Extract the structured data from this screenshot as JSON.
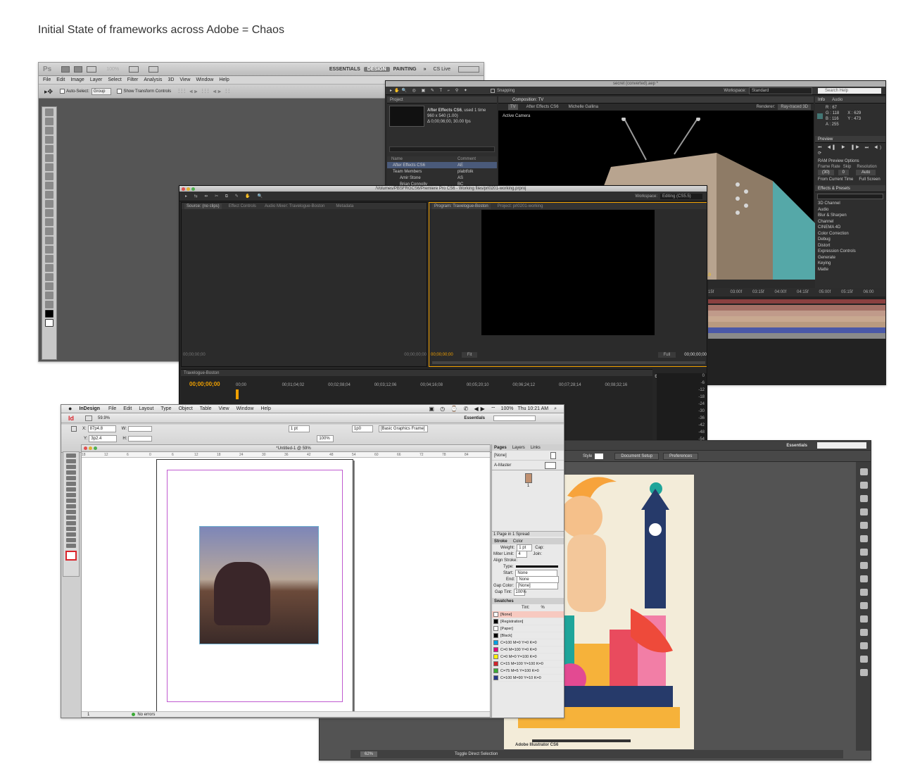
{
  "page": {
    "title": "Initial State of frameworks across Adobe = Chaos"
  },
  "photoshop": {
    "logo": "Ps",
    "zoom": "100%",
    "workspaces": [
      "ESSENTIALS",
      "DESIGN",
      "PAINTING"
    ],
    "more": "»",
    "cslive": "CS Live",
    "menus": [
      "File",
      "Edit",
      "Image",
      "Layer",
      "Select",
      "Filter",
      "Analysis",
      "3D",
      "View",
      "Window",
      "Help"
    ],
    "options": {
      "auto_select": "Auto-Select:",
      "group": "Group",
      "transform": "Show Transform Controls"
    }
  },
  "after_effects": {
    "title": "secret (converted).aep *",
    "snapping": "Snapping",
    "workspace_label": "Workspace:",
    "workspace": "Standard",
    "search_help": "Search Help",
    "project_tab": "Project",
    "project_item": "After Effects CS6",
    "project_used": ", used 1 time",
    "project_dims": "960 x 540 (1.00)",
    "project_time": "Δ 0;00;06;00, 30.00 fps",
    "col_name": "Name",
    "col_comment": "Comment",
    "rows": [
      {
        "name": "After Effects CS6",
        "comment": "AE"
      },
      {
        "name": "Team Members",
        "comment": "plabtfolk"
      },
      {
        "name": "Amir Stone",
        "comment": "AS"
      },
      {
        "name": "Brian Connolly",
        "comment": "BC"
      }
    ],
    "comp_tab": "Composition: TV",
    "comp_crumbs": [
      "TV",
      "After Effects CS6",
      "Michelle Gallina"
    ],
    "renderer_label": "Renderer:",
    "renderer": "Ray-traced 3D",
    "active_camera": "Active Camera",
    "info_tab": "Info",
    "audio_tab": "Audio",
    "info": {
      "r": "R : 67",
      "g": "G : 118",
      "b": "B : 116",
      "a": "A : 255",
      "x": "X : 629",
      "y": "Y : 473"
    },
    "preview_tab": "Preview",
    "ram_options": "RAM Preview Options",
    "frame_rate": "Frame Rate",
    "skip": "Skip",
    "resolution": "Resolution",
    "frame_rate_val": "(30)",
    "skip_val": "0",
    "res_val": "Auto",
    "from_current": "From Current Time",
    "full_screen": "Full Screen",
    "effects_tab": "Effects & Presets",
    "effects": [
      "3D Channel",
      "Audio",
      "Blur & Sharpen",
      "Channel",
      "CINEMA 4D",
      "Color Correction",
      "Debug",
      "Distort",
      "Expression Controls",
      "Generate",
      "Keying",
      "Matte"
    ],
    "offset": "+0.0",
    "ruler": [
      "15f",
      "03:00f",
      "03:15f",
      "04:00f",
      "04:15f",
      "05:00f",
      "05:15f",
      "06:00"
    ]
  },
  "premiere": {
    "title": "/Volumes/PBSFRGCS6/Premiere Pro CS6 - Working files/prl0201-working.prproj",
    "workspace_label": "Workspace:",
    "workspace": "Editing (CS5.5)",
    "source_tabs": [
      "Source: (no clips)",
      "Effect Controls",
      "Audio Mixer: Travelogue-Boston",
      "Metadata"
    ],
    "program_tabs": [
      "Program: Travelogue-Boston",
      "Project: prl0201-working"
    ],
    "tc_zero": "00;00;00;00",
    "fit": "Fit",
    "full": "Full",
    "sequence_tab": "Travelogue-Boston",
    "ruler": [
      "00;00",
      "00;01;04;02",
      "00;02;08;04",
      "00;03;12;06",
      "00;04;16;08",
      "00;05;20;10",
      "00;06;24;12",
      "00;07;28;14",
      "00;08;32;16"
    ],
    "meter": [
      "0",
      "-6",
      "-12",
      "-18",
      "-24",
      "-30",
      "-36",
      "-42",
      "-48",
      "-54"
    ]
  },
  "illustrator": {
    "essentials": "Essentials",
    "style_label": "Style",
    "doc_setup": "Document Setup",
    "preferences": "Preferences",
    "zoom": "62%",
    "status": "Toggle Direct Selection",
    "footer_text": "Adobe Illustrator CS6"
  },
  "indesign": {
    "app": "InDesign",
    "menus": [
      "File",
      "Edit",
      "Layout",
      "Type",
      "Object",
      "Table",
      "View",
      "Window",
      "Help"
    ],
    "clock": "Thu 10:21 AM",
    "battery": "100%",
    "zoom": "59.9%",
    "essentials": "Essentials",
    "x_val": "87p4.8",
    "y_val": "3p2.4",
    "x_label": "X:",
    "y_label": "Y:",
    "w_label": "W:",
    "h_label": "H:",
    "stroke_weight": "1 pt",
    "pct": "100%",
    "frame_style": "[Basic Graphics Frame]",
    "opacity": "1p0",
    "doc_tab": "*Untitled-1 @ 59%",
    "ruler": [
      "18",
      "12",
      "6",
      "0",
      "6",
      "12",
      "18",
      "24",
      "30",
      "36",
      "42",
      "48",
      "54",
      "60",
      "66",
      "72",
      "78",
      "84"
    ],
    "panels": {
      "pages": "Pages",
      "layers": "Layers",
      "links": "Links",
      "none": "[None]",
      "master": "A-Master",
      "page_num": "1",
      "spread": "1 Page in 1 Spread"
    },
    "stroke": {
      "tab": "Stroke",
      "color_tab": "Color",
      "weight": "Weight:",
      "weight_val": "1 pt",
      "cap": "Cap:",
      "miter": "Miter Limit:",
      "miter_val": "4",
      "join": "Join:",
      "align": "Align Stroke:",
      "type": "Type:",
      "start": "Start:",
      "end": "End:",
      "gap_color": "Gap Color:",
      "gap_tint": "Gap Tint:",
      "none": "None",
      "gap_none": "[None]",
      "gap_tint_val": "100%"
    },
    "swatches_tab": "Swatches",
    "tint": "Tint:",
    "tint_pct": "%",
    "swatches": [
      {
        "name": "[None]",
        "color": "#ffffff"
      },
      {
        "name": "[Registration]",
        "color": "#000000"
      },
      {
        "name": "[Paper]",
        "color": "#ffffff"
      },
      {
        "name": "[Black]",
        "color": "#000000"
      },
      {
        "name": "C=100 M=0 Y=0 K=0",
        "color": "#00a0e3"
      },
      {
        "name": "C=0 M=100 Y=0 K=0",
        "color": "#e3007e"
      },
      {
        "name": "C=0 M=0 Y=100 K=0",
        "color": "#fff200"
      },
      {
        "name": "C=15 M=100 Y=100 K=0",
        "color": "#d2232a"
      },
      {
        "name": "C=75 M=5 Y=100 K=0",
        "color": "#3aaa35"
      },
      {
        "name": "C=100 M=90 Y=10 K=0",
        "color": "#263a8a"
      }
    ],
    "status_page": "1",
    "errors": "No errors"
  },
  "colors": {
    "ps_bg": "#555555",
    "ae_bg": "#2a2a2a",
    "pr_bg": "#262626",
    "ai_bg": "#535353",
    "id_accent": "#d9232a",
    "pr_accent": "#f0a000"
  }
}
